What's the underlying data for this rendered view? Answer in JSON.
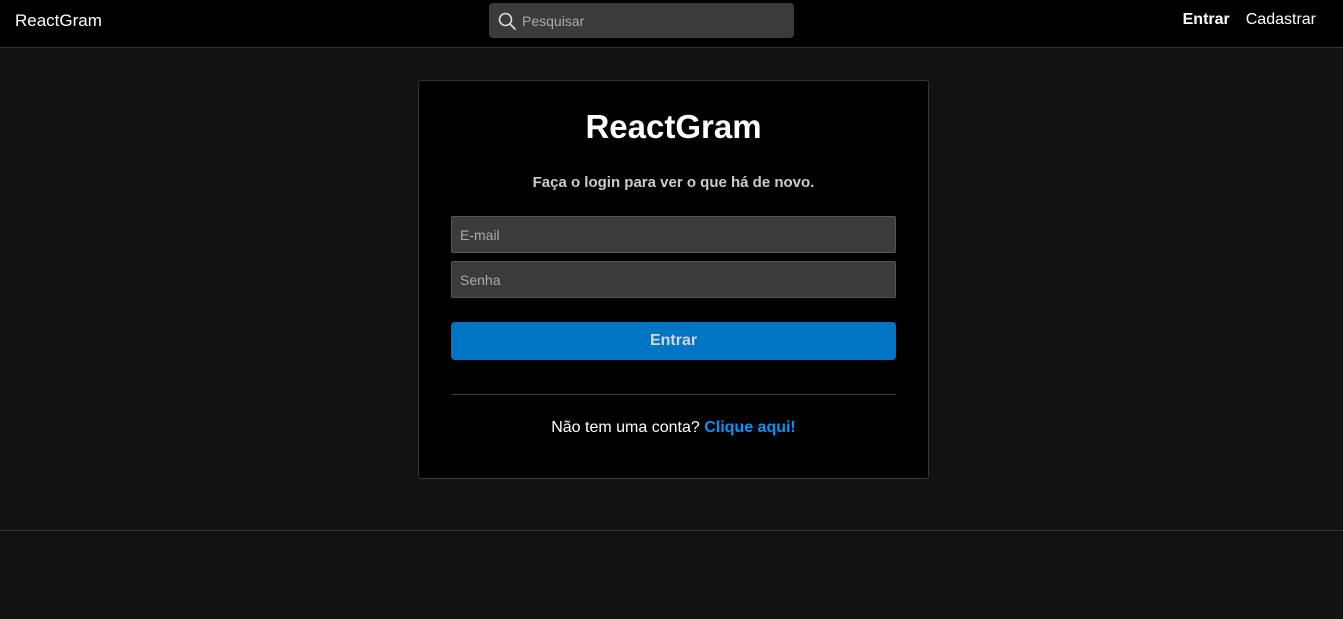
{
  "navbar": {
    "brand": "ReactGram",
    "search_placeholder": "Pesquisar",
    "links": {
      "login": "Entrar",
      "register": "Cadastrar"
    }
  },
  "login": {
    "title": "ReactGram",
    "subtitle": "Faça o login para ver o que há de novo.",
    "email_placeholder": "E-mail",
    "password_placeholder": "Senha",
    "submit_label": "Entrar",
    "no_account_text": "Não tem uma conta?",
    "signup_link": "Clique aqui!"
  },
  "colors": {
    "background": "#121212",
    "card": "#000000",
    "input": "#3b3b3b",
    "button": "#0075c4",
    "link": "#0095f6"
  }
}
